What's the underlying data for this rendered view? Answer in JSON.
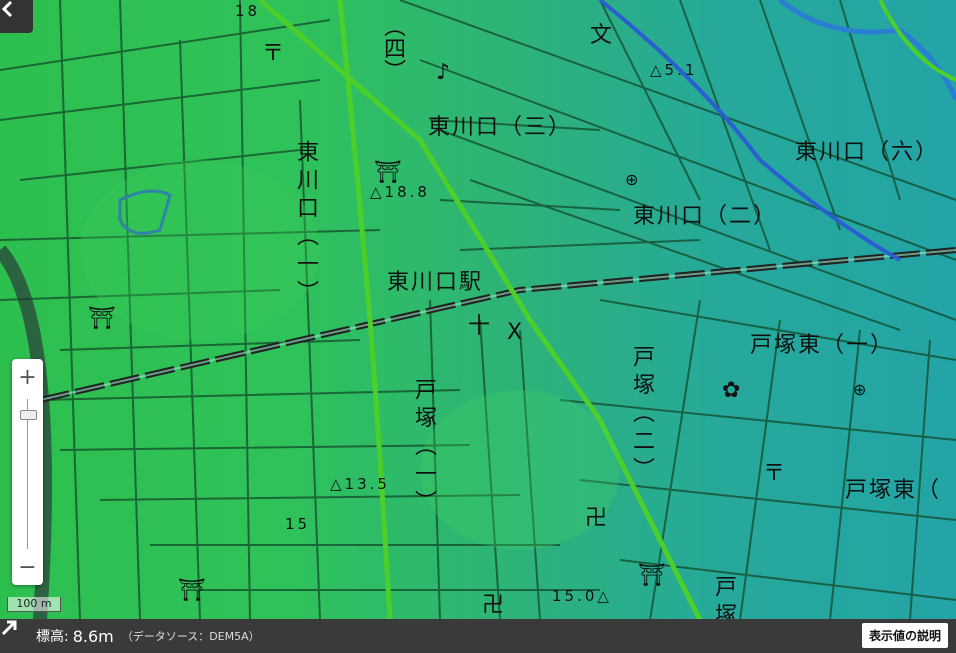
{
  "map": {
    "area_labels": [
      {
        "id": "higashikawaguchi-3",
        "text": "東川口（三）"
      },
      {
        "id": "higashikawaguchi-6",
        "text": "東川口（六）"
      },
      {
        "id": "higashikawaguchi-2",
        "text": "東川口（二）"
      },
      {
        "id": "higashikawaguchi-1",
        "text": "東川口（一）"
      },
      {
        "id": "totsukahigashi-1",
        "text": "戸塚東（一）"
      },
      {
        "id": "totsukahigashi-partial",
        "text": "戸塚東（"
      },
      {
        "id": "totsuka-1",
        "text": "戸塚（一）"
      },
      {
        "id": "totsuka-2",
        "text": "戸塚（二）"
      },
      {
        "id": "totsuka-partial",
        "text": "戸塚"
      },
      {
        "id": "station",
        "text": "東川口駅"
      },
      {
        "id": "yon",
        "text": "（四）"
      }
    ],
    "elevation_points": [
      {
        "id": "elev-18-8",
        "text": "△18.8"
      },
      {
        "id": "elev-5-1",
        "text": "△5.1"
      },
      {
        "id": "elev-13-5",
        "text": "△13.5"
      },
      {
        "id": "elev-15-0",
        "text": "15.0△"
      },
      {
        "id": "elev-18-top",
        "text": "18"
      },
      {
        "id": "elev-15-partial",
        "text": "15"
      }
    ],
    "symbols": {
      "shrine": "⛩",
      "temple": "卍",
      "school": "文",
      "police": "X",
      "hospital": "⊕",
      "post": "〒",
      "factory": "✿"
    }
  },
  "controls": {
    "back_icon": "chevron-left-icon",
    "zoom_in": "+",
    "zoom_out": "−",
    "scale_label": "100 m",
    "zoom_level_fraction": 0.08
  },
  "status": {
    "label": "標高:",
    "value": "8.6m",
    "source": "（データソース：DEM5A）",
    "explain_button": "表示値の説明"
  },
  "colors": {
    "map_green": "#2dbf4e",
    "map_teal": "#23a4a6",
    "rail_green": "#4ccf2a",
    "river_blue": "#2a5fd0",
    "statusbar": "#3a3a3a"
  }
}
